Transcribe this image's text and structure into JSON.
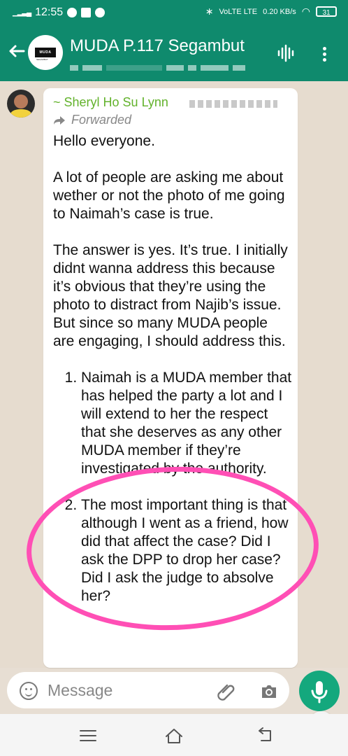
{
  "status_bar": {
    "time": "12:55",
    "network_text": "VoLTE LTE",
    "speed": "0.20 KB/s",
    "battery": "31"
  },
  "header": {
    "title": "MUDA P.117 Segambut",
    "avatar_text": "MUDA",
    "avatar_subtext": "SEGAMBUT",
    "icons": [
      "back-arrow-icon",
      "voice-chat-icon",
      "more-menu-icon"
    ]
  },
  "message": {
    "sender_name": "~ Sheryl Ho Su Lynn",
    "forwarded_label": "Forwarded",
    "paragraphs": [
      "Hello everyone.",
      "A lot of people are asking me about wether or not the photo of me going to Naimah’s case is true.",
      "The answer is yes. It’s true. I initially didnt wanna address this because it’s obvious that they’re using the photo to distract from Najib’s issue. But since so many MUDA people are engaging, I should address this."
    ],
    "points": [
      "Naimah is a MUDA member that has helped the party a lot and I will extend to her the respect that she deserves as any other MUDA member if they’re investigated by the authority.",
      "The most important thing is that although I went as a friend, how did that affect the case? Did I ask the DPP to drop her case? Did I ask the judge to absolve her?"
    ]
  },
  "composer": {
    "placeholder": "Message"
  },
  "colors": {
    "header": "#0f8a6d",
    "sender": "#62b22b",
    "highlight": "#ff4fb5",
    "mic_button": "#14a87d"
  }
}
